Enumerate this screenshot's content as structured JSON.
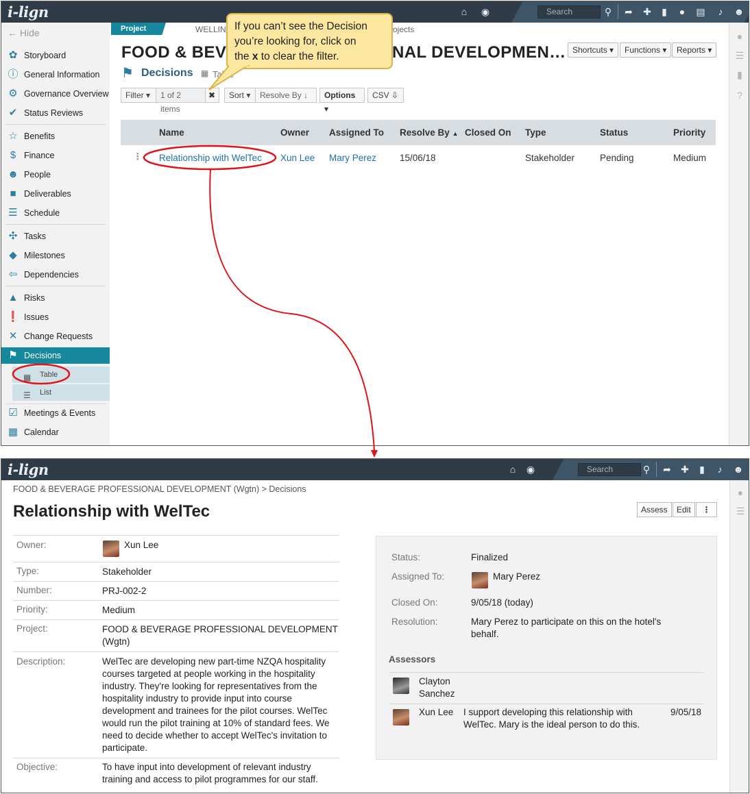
{
  "app": {
    "logo": "i-lign",
    "search_placeholder": "Search"
  },
  "callout": {
    "line1": "If you can’t see the Decision",
    "line2": "you’re looking for, click on",
    "line3_pre": "the ",
    "line3_x": "x",
    "line3_post": " to clear the filter."
  },
  "sidebar": {
    "hide": "Hide",
    "items": [
      {
        "label": "Storyboard",
        "icon": "palette-icon"
      },
      {
        "label": "General Information",
        "icon": "info-icon"
      },
      {
        "label": "Governance Overview",
        "icon": "governance-icon"
      },
      {
        "label": "Status Reviews",
        "icon": "check-icon"
      },
      {
        "label": "Benefits",
        "icon": "star-icon"
      },
      {
        "label": "Finance",
        "icon": "dollar-icon"
      },
      {
        "label": "People",
        "icon": "people-icon"
      },
      {
        "label": "Deliverables",
        "icon": "truck-icon"
      },
      {
        "label": "Schedule",
        "icon": "schedule-icon"
      },
      {
        "label": "Tasks",
        "icon": "tasks-icon"
      },
      {
        "label": "Milestones",
        "icon": "diamond-icon"
      },
      {
        "label": "Dependencies",
        "icon": "dependencies-icon"
      },
      {
        "label": "Risks",
        "icon": "warning-icon"
      },
      {
        "label": "Issues",
        "icon": "exclamation-icon"
      },
      {
        "label": "Change Requests",
        "icon": "change-icon"
      },
      {
        "label": "Decisions",
        "icon": "signpost-icon"
      },
      {
        "label": "Meetings & Events",
        "icon": "calendar-check-icon"
      },
      {
        "label": "Calendar",
        "icon": "calendar-icon"
      }
    ],
    "sub_table": "Table",
    "sub_list": "List"
  },
  "project": {
    "pill": "Project",
    "crumb_left": "WELLIN",
    "crumb_right": "rojects",
    "title_left": "FOOD & BEV",
    "title_right": "NAL DEVELOPMEN…",
    "shortcuts": "Shortcuts",
    "functions": "Functions",
    "reports": "Reports",
    "section": "Decisions",
    "view": "Table"
  },
  "toolbar": {
    "filter": "Filter",
    "count": "1 of 2 items",
    "clear": "✖",
    "sort": "Sort",
    "sort_by": "Resolve By",
    "options": "Options",
    "csv": "CSV"
  },
  "table": {
    "headers": [
      "Name",
      "Owner",
      "Assigned To",
      "Resolve By",
      "Closed On",
      "Type",
      "Status",
      "Priority"
    ],
    "row": {
      "name": "Relationship with WelTec",
      "owner": "Xun Lee",
      "assigned": "Mary Perez",
      "resolve_by": "15/06/18",
      "closed_on": "",
      "type": "Stakeholder",
      "status": "Pending",
      "priority": "Medium"
    }
  },
  "detail": {
    "breadcrumb": "FOOD & BEVERAGE PROFESSIONAL DEVELOPMENT (Wgtn) > Decisions",
    "title": "Relationship with WelTec",
    "assess": "Assess",
    "edit": "Edit",
    "more": "⋮",
    "fields": {
      "owner_label": "Owner:",
      "owner": "Xun Lee",
      "type_label": "Type:",
      "type": "Stakeholder",
      "number_label": "Number:",
      "number": "PRJ-002-2",
      "priority_label": "Priority:",
      "priority": "Medium",
      "project_label": "Project:",
      "project_line1": "FOOD & BEVERAGE PROFESSIONAL DEVELOPMENT",
      "project_line2": "(Wgtn)",
      "description_label": "Description:",
      "description": [
        "WelTec are developing new part-time NZQA hospitality",
        "courses targeted at people working in the hospitality",
        "industry. They're looking for representatives from the",
        "hospitality industry to provide input into course",
        "development and trainees for the pilot courses. WelTec",
        "would run the pilot training at 10% of standard fees. We",
        "need to decide whether to accept WelTec's invitation to",
        "participate."
      ],
      "objective_label": "Objective:",
      "objective": [
        "To have input into development of relevant industry",
        "training and access to pilot programmes for our staff."
      ]
    },
    "panel": {
      "status_label": "Status:",
      "status": "Finalized",
      "assigned_label": "Assigned To:",
      "assigned": "Mary Perez",
      "closed_label": "Closed On:",
      "closed": "9/05/18 (today)",
      "resolution_label": "Resolution:",
      "resolution": [
        "Mary Perez to participate on this on the hotel's",
        "behalf."
      ],
      "assessors_title": "Assessors",
      "assessor1": [
        "Clayton",
        "Sanchez"
      ],
      "assessor2": "Xun Lee",
      "assessor2_comment": [
        "I support developing this relationship with",
        "WelTec. Mary is the ideal person to do this."
      ],
      "assessor2_date": "9/05/18"
    }
  },
  "colors": {
    "accent": "#15889d",
    "topbar": "#2f3b47",
    "link": "#1f72a8",
    "callout": "#fbe7a0",
    "annotation": "#e0141b"
  }
}
